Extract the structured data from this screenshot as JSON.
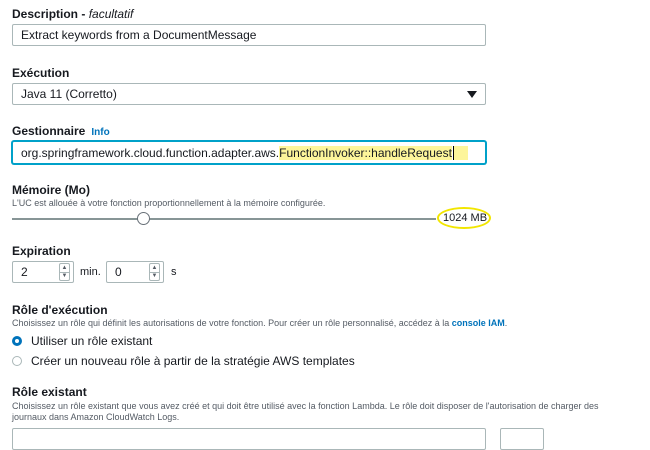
{
  "description": {
    "label": "Description",
    "optional": "facultatif",
    "value": "Extract keywords from a DocumentMessage"
  },
  "runtime": {
    "label": "Exécution",
    "value": "Java 11 (Corretto)"
  },
  "handler": {
    "label": "Gestionnaire",
    "info_link": "Info",
    "value_plain": "org.springframework.cloud.function.adapter.aws.",
    "value_highlighted": "FunctionInvoker::handleRequest"
  },
  "memory": {
    "label": "Mémoire (Mo)",
    "help": "L'UC est allouée à votre fonction proportionnellement à la mémoire configurée.",
    "value_label": "1024 MB",
    "slider_fraction": 0.31
  },
  "timeout": {
    "label": "Expiration",
    "minutes": "2",
    "minutes_unit": "min.",
    "seconds": "0",
    "seconds_unit": "s"
  },
  "role": {
    "label": "Rôle d'exécution",
    "help_prefix": "Choisissez un rôle qui définit les autorisations de votre fonction. Pour créer un rôle personnalisé, accédez à la ",
    "help_link": "console IAM",
    "help_suffix": ".",
    "options": [
      {
        "label": "Utiliser un rôle existant",
        "selected": true
      },
      {
        "label": "Créer un nouveau rôle à partir de la stratégie AWS templates",
        "selected": false
      }
    ]
  },
  "existing_role": {
    "label": "Rôle existant",
    "help_line1": "Choisissez un rôle existant que vous avez créé et qui doit être utilisé avec la fonction Lambda. Le rôle doit disposer de l'autorisation de charger des",
    "help_line2": "journaux dans Amazon CloudWatch Logs."
  },
  "colors": {
    "accent": "#0073bb",
    "highlight": "#fdf59a",
    "annotation": "#f2e600"
  },
  "icons": {
    "dropdown": "caret-down-icon",
    "stepper_up": "chevron-up-icon",
    "stepper_down": "chevron-down-icon"
  }
}
